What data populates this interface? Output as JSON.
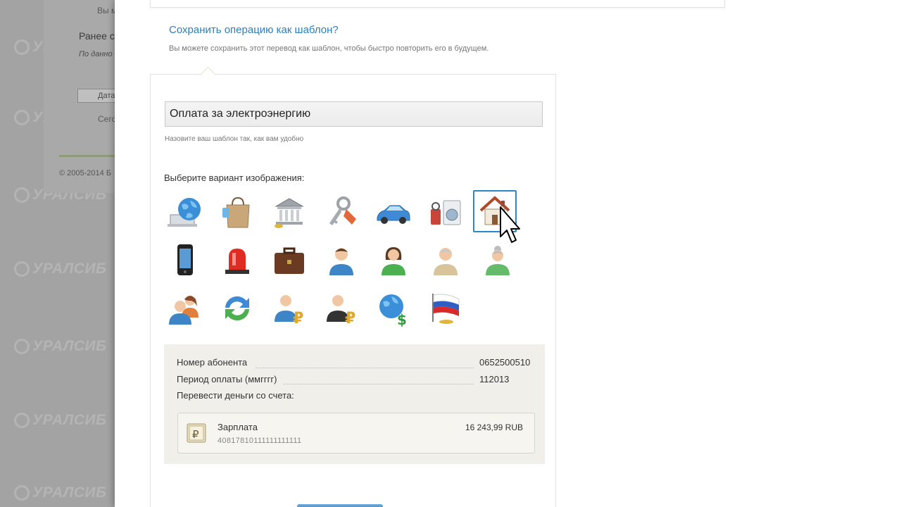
{
  "background": {
    "logo_text": "УРАЛСИБ",
    "partial_texts": {
      "line1": "Вы м",
      "heading": "Ранее с",
      "italic": "По данно",
      "button": "Дата",
      "today": "Сего"
    },
    "copyright": "© 2005-2014 Б"
  },
  "template": {
    "save_link": "Сохранить операцию как шаблон?",
    "save_hint": "Вы можете сохранить этот перевод как шаблон, чтобы быстро повторить его в будущем.",
    "name_value": "Оплата за электроэнергию",
    "name_hint": "Назовите ваш шаблон так, как вам удобно",
    "choose_label": "Выберите вариант изображения:",
    "selected_icon": "house-icon",
    "icons": [
      "laptop-globe-icon",
      "shopping-bag-icon",
      "bank-icon",
      "keys-icon",
      "car-icon",
      "appliances-icon",
      "house-icon",
      "mobile-phone-icon",
      "alarm-siren-icon",
      "briefcase-icon",
      "man-icon",
      "woman-icon",
      "elderly-man-icon",
      "elderly-woman-icon",
      "family-icon",
      "exchange-arrows-icon",
      "businessman-ruble-icon",
      "businessman-ruble-dark-icon",
      "globe-dollar-icon",
      "russian-flag-icon"
    ]
  },
  "details": {
    "subscriber_label": "Номер абонента",
    "subscriber_value": "0652500510",
    "period_label": "Период оплаты (ммгггг)",
    "period_value": "112013",
    "from_account_label": "Перевести деньги со счета:",
    "account": {
      "name": "Зарплата",
      "number": "40817810111111111111",
      "balance": "16 243,99 RUB"
    }
  },
  "colors": {
    "link": "#2c7fb8",
    "selection": "#2d86c8",
    "details_bg": "#f0efe9"
  }
}
